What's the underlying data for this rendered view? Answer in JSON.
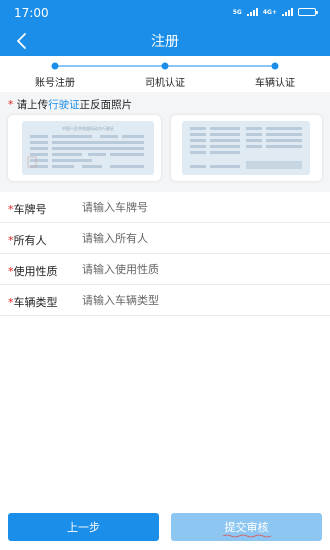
{
  "status_bar": {
    "time": "17:00",
    "network_1": "5G",
    "network_2": "4G+",
    "battery_level": 0.6
  },
  "header": {
    "title": "注册",
    "back_icon": "chevron-left-icon"
  },
  "steps": {
    "items": [
      {
        "label": "账号注册",
        "state": "done"
      },
      {
        "label": "司机认证",
        "state": "done"
      },
      {
        "label": "车辆认证",
        "state": "current"
      }
    ],
    "color_active": "#1a8ee8"
  },
  "upload": {
    "required_mark": "*",
    "prefix": " 请上传",
    "link_text": "行驶证",
    "suffix": "正反面照片",
    "front_caption": "中国人民共和国机动车行驶证"
  },
  "form": {
    "fields": [
      {
        "required_mark": "*",
        "label": "车牌号",
        "placeholder": "请输入车牌号",
        "value": ""
      },
      {
        "required_mark": "*",
        "label": "所有人",
        "placeholder": "请输入所有人",
        "value": ""
      },
      {
        "required_mark": "*",
        "label": "使用性质",
        "placeholder": "请输入使用性质",
        "value": ""
      },
      {
        "required_mark": "*",
        "label": "车辆类型",
        "placeholder": "请输入车辆类型",
        "value": ""
      }
    ]
  },
  "actions": {
    "prev_label": "上一步",
    "submit_label": "提交审核"
  },
  "colors": {
    "primary": "#1a8ee8",
    "primary_disabled": "#8ec6f2",
    "required": "#e02020",
    "background": "#f4f5f7"
  }
}
